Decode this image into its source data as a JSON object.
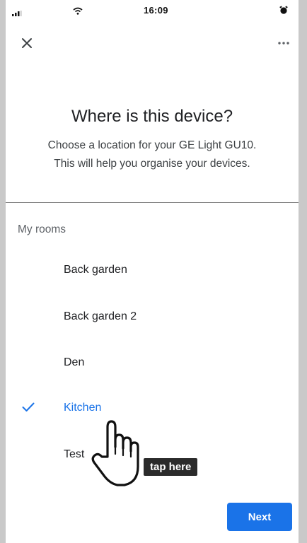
{
  "status_bar": {
    "time": "16:09",
    "signal_icon": "signal-bars-icon",
    "wifi_icon": "wifi-icon",
    "alarm_icon": "alarm-clock-icon"
  },
  "header": {
    "close_icon": "close-icon",
    "more_icon": "more-horizontal-icon"
  },
  "main": {
    "title": "Where is this device?",
    "subtitle_line1": "Choose a location for your GE Light GU10.",
    "subtitle_line2": "This will help you organise your devices."
  },
  "rooms": {
    "section_label": "My rooms",
    "items": [
      {
        "label": "Back garden",
        "selected": false
      },
      {
        "label": "Back garden 2",
        "selected": false
      },
      {
        "label": "Den",
        "selected": false
      },
      {
        "label": "Kitchen",
        "selected": true
      },
      {
        "label": "Test",
        "selected": false
      }
    ]
  },
  "overlay": {
    "tooltip": "tap here",
    "hand_icon": "pointing-hand-icon"
  },
  "footer": {
    "next_label": "Next"
  },
  "colors": {
    "accent": "#1a73e8",
    "tooltip_bg": "#2b2b2b",
    "outer_bg": "#c9c9c9"
  }
}
